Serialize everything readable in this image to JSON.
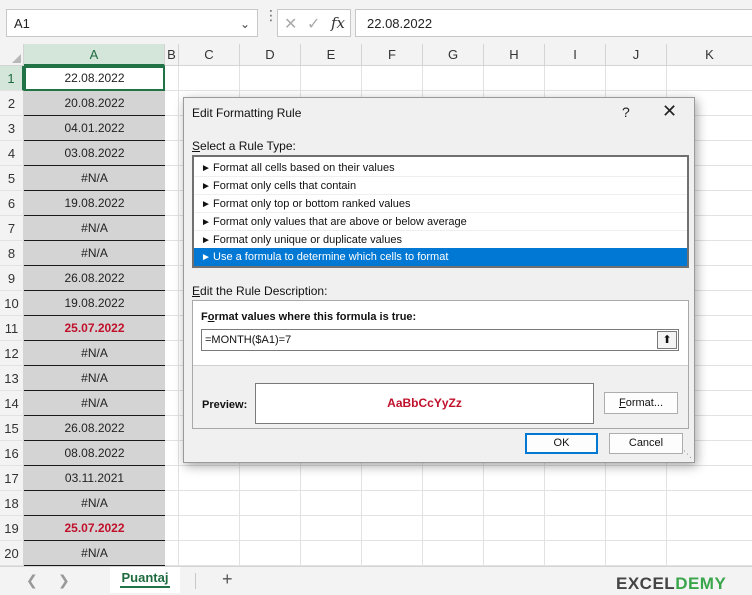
{
  "formula_bar": {
    "name_box": "A1",
    "formula": "22.08.2022",
    "icons": [
      "cancel-x-icon",
      "confirm-check-icon",
      "fx-icon"
    ]
  },
  "grid": {
    "columns": [
      "A",
      "B",
      "C",
      "D",
      "E",
      "F",
      "G",
      "H",
      "I",
      "J",
      "K"
    ],
    "rows": [
      "1",
      "2",
      "3",
      "4",
      "5",
      "6",
      "7",
      "8",
      "9",
      "10",
      "11",
      "12",
      "13",
      "14",
      "15",
      "16",
      "17",
      "18",
      "19",
      "20"
    ],
    "column_a": [
      "22.08.2022",
      "20.08.2022",
      "04.01.2022",
      "03.08.2022",
      "#N/A",
      "19.08.2022",
      "#N/A",
      "#N/A",
      "26.08.2022",
      "19.08.2022",
      "25.07.2022",
      "#N/A",
      "#N/A",
      "#N/A",
      "26.08.2022",
      "08.08.2022",
      "03.11.2021",
      "#N/A",
      "25.07.2022",
      "#N/A"
    ],
    "highlight_color": "#c0102b",
    "selection_color": "#217346"
  },
  "sheet_tabs": {
    "active": "Puantaj",
    "add_icon": "plus-icon",
    "logo_text": "EXCEL",
    "logo_accent": "DEMY"
  },
  "dialog": {
    "title": "Edit Formatting Rule",
    "help": "?",
    "close": "✕",
    "select_rule_type_label_u": "S",
    "select_rule_type_label_rest": "elect a Rule Type:",
    "rule_types": [
      "Format all cells based on their values",
      "Format only cells that contain",
      "Format only top or bottom ranked values",
      "Format only values that are above or below average",
      "Format only unique or duplicate values",
      "Use a formula to determine which cells to format"
    ],
    "edit_description_label_u": "E",
    "edit_description_label_rest": "dit the Rule Description:",
    "formula_label_pre": "F",
    "formula_label_u": "o",
    "formula_label_rest": "rmat values where this formula is true:",
    "formula_value": "=MONTH($A1)=7",
    "preview_label": "Preview:",
    "preview_text": "AaBbCcYyZz",
    "format_button_u": "F",
    "format_button_rest": "ormat...",
    "ok_button": "OK",
    "cancel_button": "Cancel",
    "accent_color": "#0078d4"
  }
}
